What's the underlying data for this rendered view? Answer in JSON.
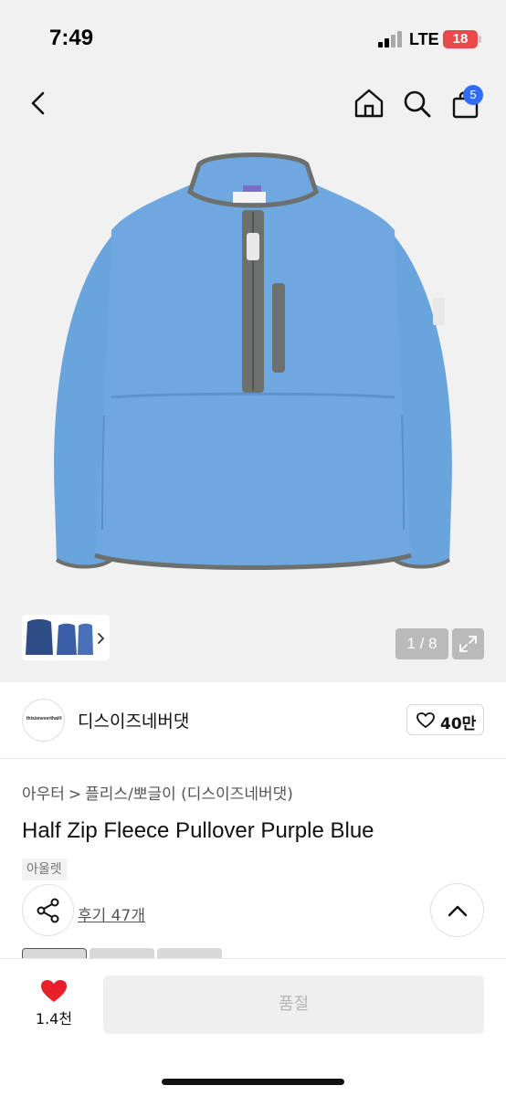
{
  "status_bar": {
    "time": "7:49",
    "network": "LTE",
    "battery": "18"
  },
  "header": {
    "back_icon": "chevron-left-icon",
    "home_icon": "home-icon",
    "search_icon": "search-icon",
    "cart_icon": "shopping-bag-icon",
    "cart_badge": "5"
  },
  "gallery": {
    "counter": "1 / 8",
    "current_image": 1,
    "total_images": 8,
    "expand_icon": "expand-icon",
    "thumb_more_icon": "chevron-right-icon"
  },
  "brand": {
    "logo_text": "thisisneverthat®",
    "name": "디스이즈네버댓",
    "like_icon": "heart-outline-icon",
    "like_count": "40만"
  },
  "product": {
    "breadcrumb": [
      "아우터",
      "플리스/뽀글이 (디스이즈네버댓)"
    ],
    "title": "Half Zip Fleece Pullover Purple Blue",
    "tag": "아울렛",
    "share_icon": "share-icon",
    "reviews_label": "후기 47개",
    "top_icon": "chevron-up-icon"
  },
  "bottom_bar": {
    "wish_icon": "heart-filled-icon",
    "wish_count": "1.4천",
    "buy_label": "품절"
  },
  "colors": {
    "accent_blue": "#2f6df6",
    "garment_blue": "#6aa4dd",
    "trim_gray": "#6d706c",
    "heart_red": "#e8202a",
    "battery_red": "#e84a4a"
  }
}
